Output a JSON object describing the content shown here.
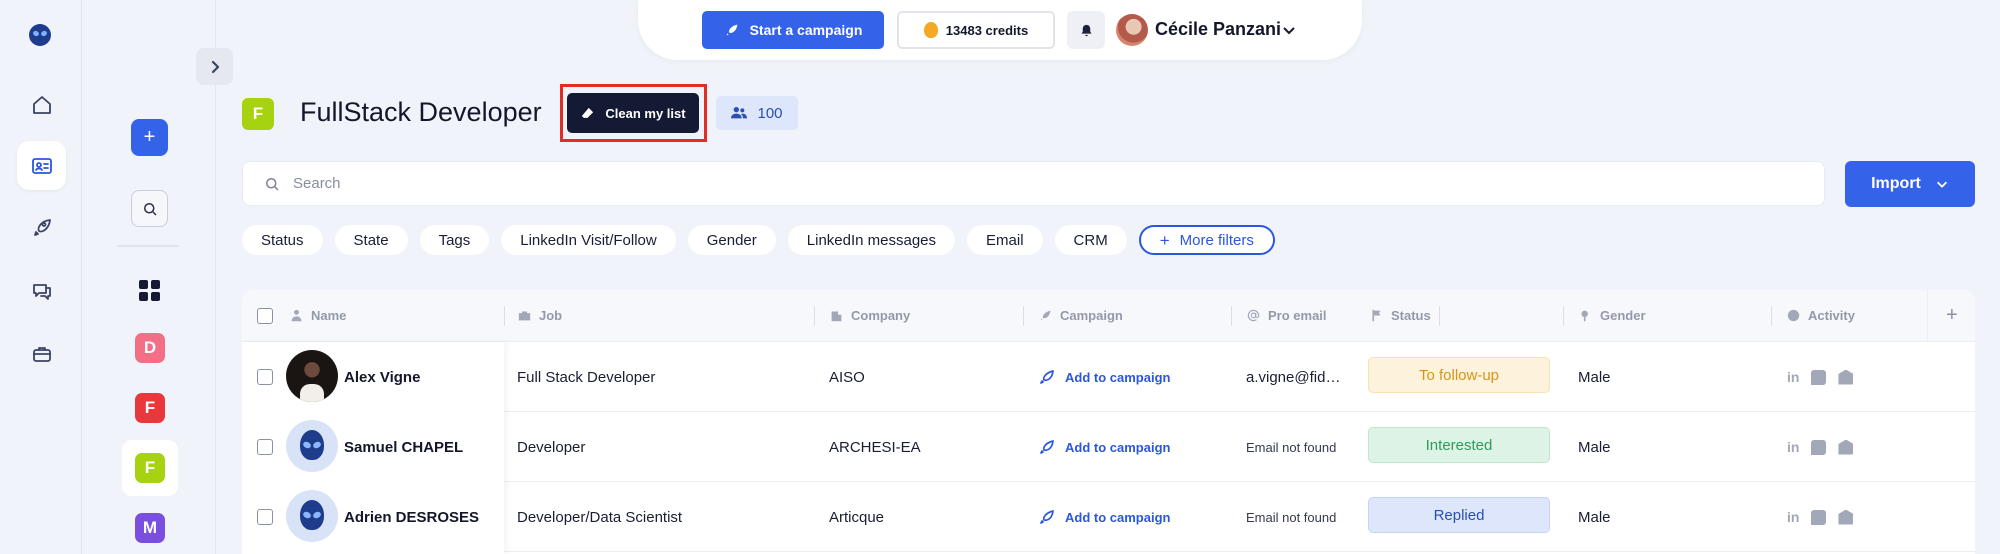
{
  "topbar": {
    "start_campaign": "Start a campaign",
    "credits": "13483 credits",
    "user_name": "Cécile Panzani"
  },
  "sidebar": {
    "items": [
      {
        "icon": "home-icon"
      },
      {
        "icon": "contacts-icon",
        "active": true
      },
      {
        "icon": "rocket-icon"
      },
      {
        "icon": "chat-icon"
      },
      {
        "icon": "briefcase-icon"
      }
    ]
  },
  "lists": {
    "items": [
      {
        "letter": "D",
        "color": "#f26f86"
      },
      {
        "letter": "F",
        "color": "#e8383b"
      },
      {
        "letter": "F",
        "color": "#a6d212",
        "active": true
      },
      {
        "letter": "M",
        "color": "#7a4fe0"
      }
    ]
  },
  "header": {
    "badge_letter": "F",
    "title": "FullStack Developer",
    "clean_button": "Clean my list",
    "contact_count": "100"
  },
  "search": {
    "placeholder": "Search",
    "import_label": "Import"
  },
  "filters": [
    "Status",
    "State",
    "Tags",
    "LinkedIn Visit/Follow",
    "Gender",
    "LinkedIn messages",
    "Email",
    "CRM"
  ],
  "more_filters": "More filters",
  "table": {
    "columns": [
      "Name",
      "Job",
      "Company",
      "Campaign",
      "Pro email",
      "Status",
      "Gender",
      "Activity"
    ],
    "rows": [
      {
        "name": "Alex Vigne",
        "job": "Full Stack Developer",
        "company": "AISO",
        "campaign": "Add to campaign",
        "email": "a.vigne@fid…",
        "status": "To follow-up",
        "status_bg": "#fdf3dc",
        "status_fg": "#d99316",
        "gender": "Male"
      },
      {
        "name": "Samuel CHAPEL",
        "job": "Developer",
        "company": "ARCHESI-EA",
        "campaign": "Add to campaign",
        "email": "Email not found",
        "status": "Interested",
        "status_bg": "#dcf3e5",
        "status_fg": "#2e9c5c",
        "gender": "Male"
      },
      {
        "name": "Adrien DESROSES",
        "job": "Developer/Data Scientist",
        "company": "Articque",
        "campaign": "Add to campaign",
        "email": "Email not found",
        "status": "Replied",
        "status_bg": "#dde6fb",
        "status_fg": "#2b4fb3",
        "gender": "Male"
      }
    ]
  },
  "colors": {
    "accent": "#3463ea",
    "dark_button": "#151a34",
    "highlight": "#e12d22"
  }
}
